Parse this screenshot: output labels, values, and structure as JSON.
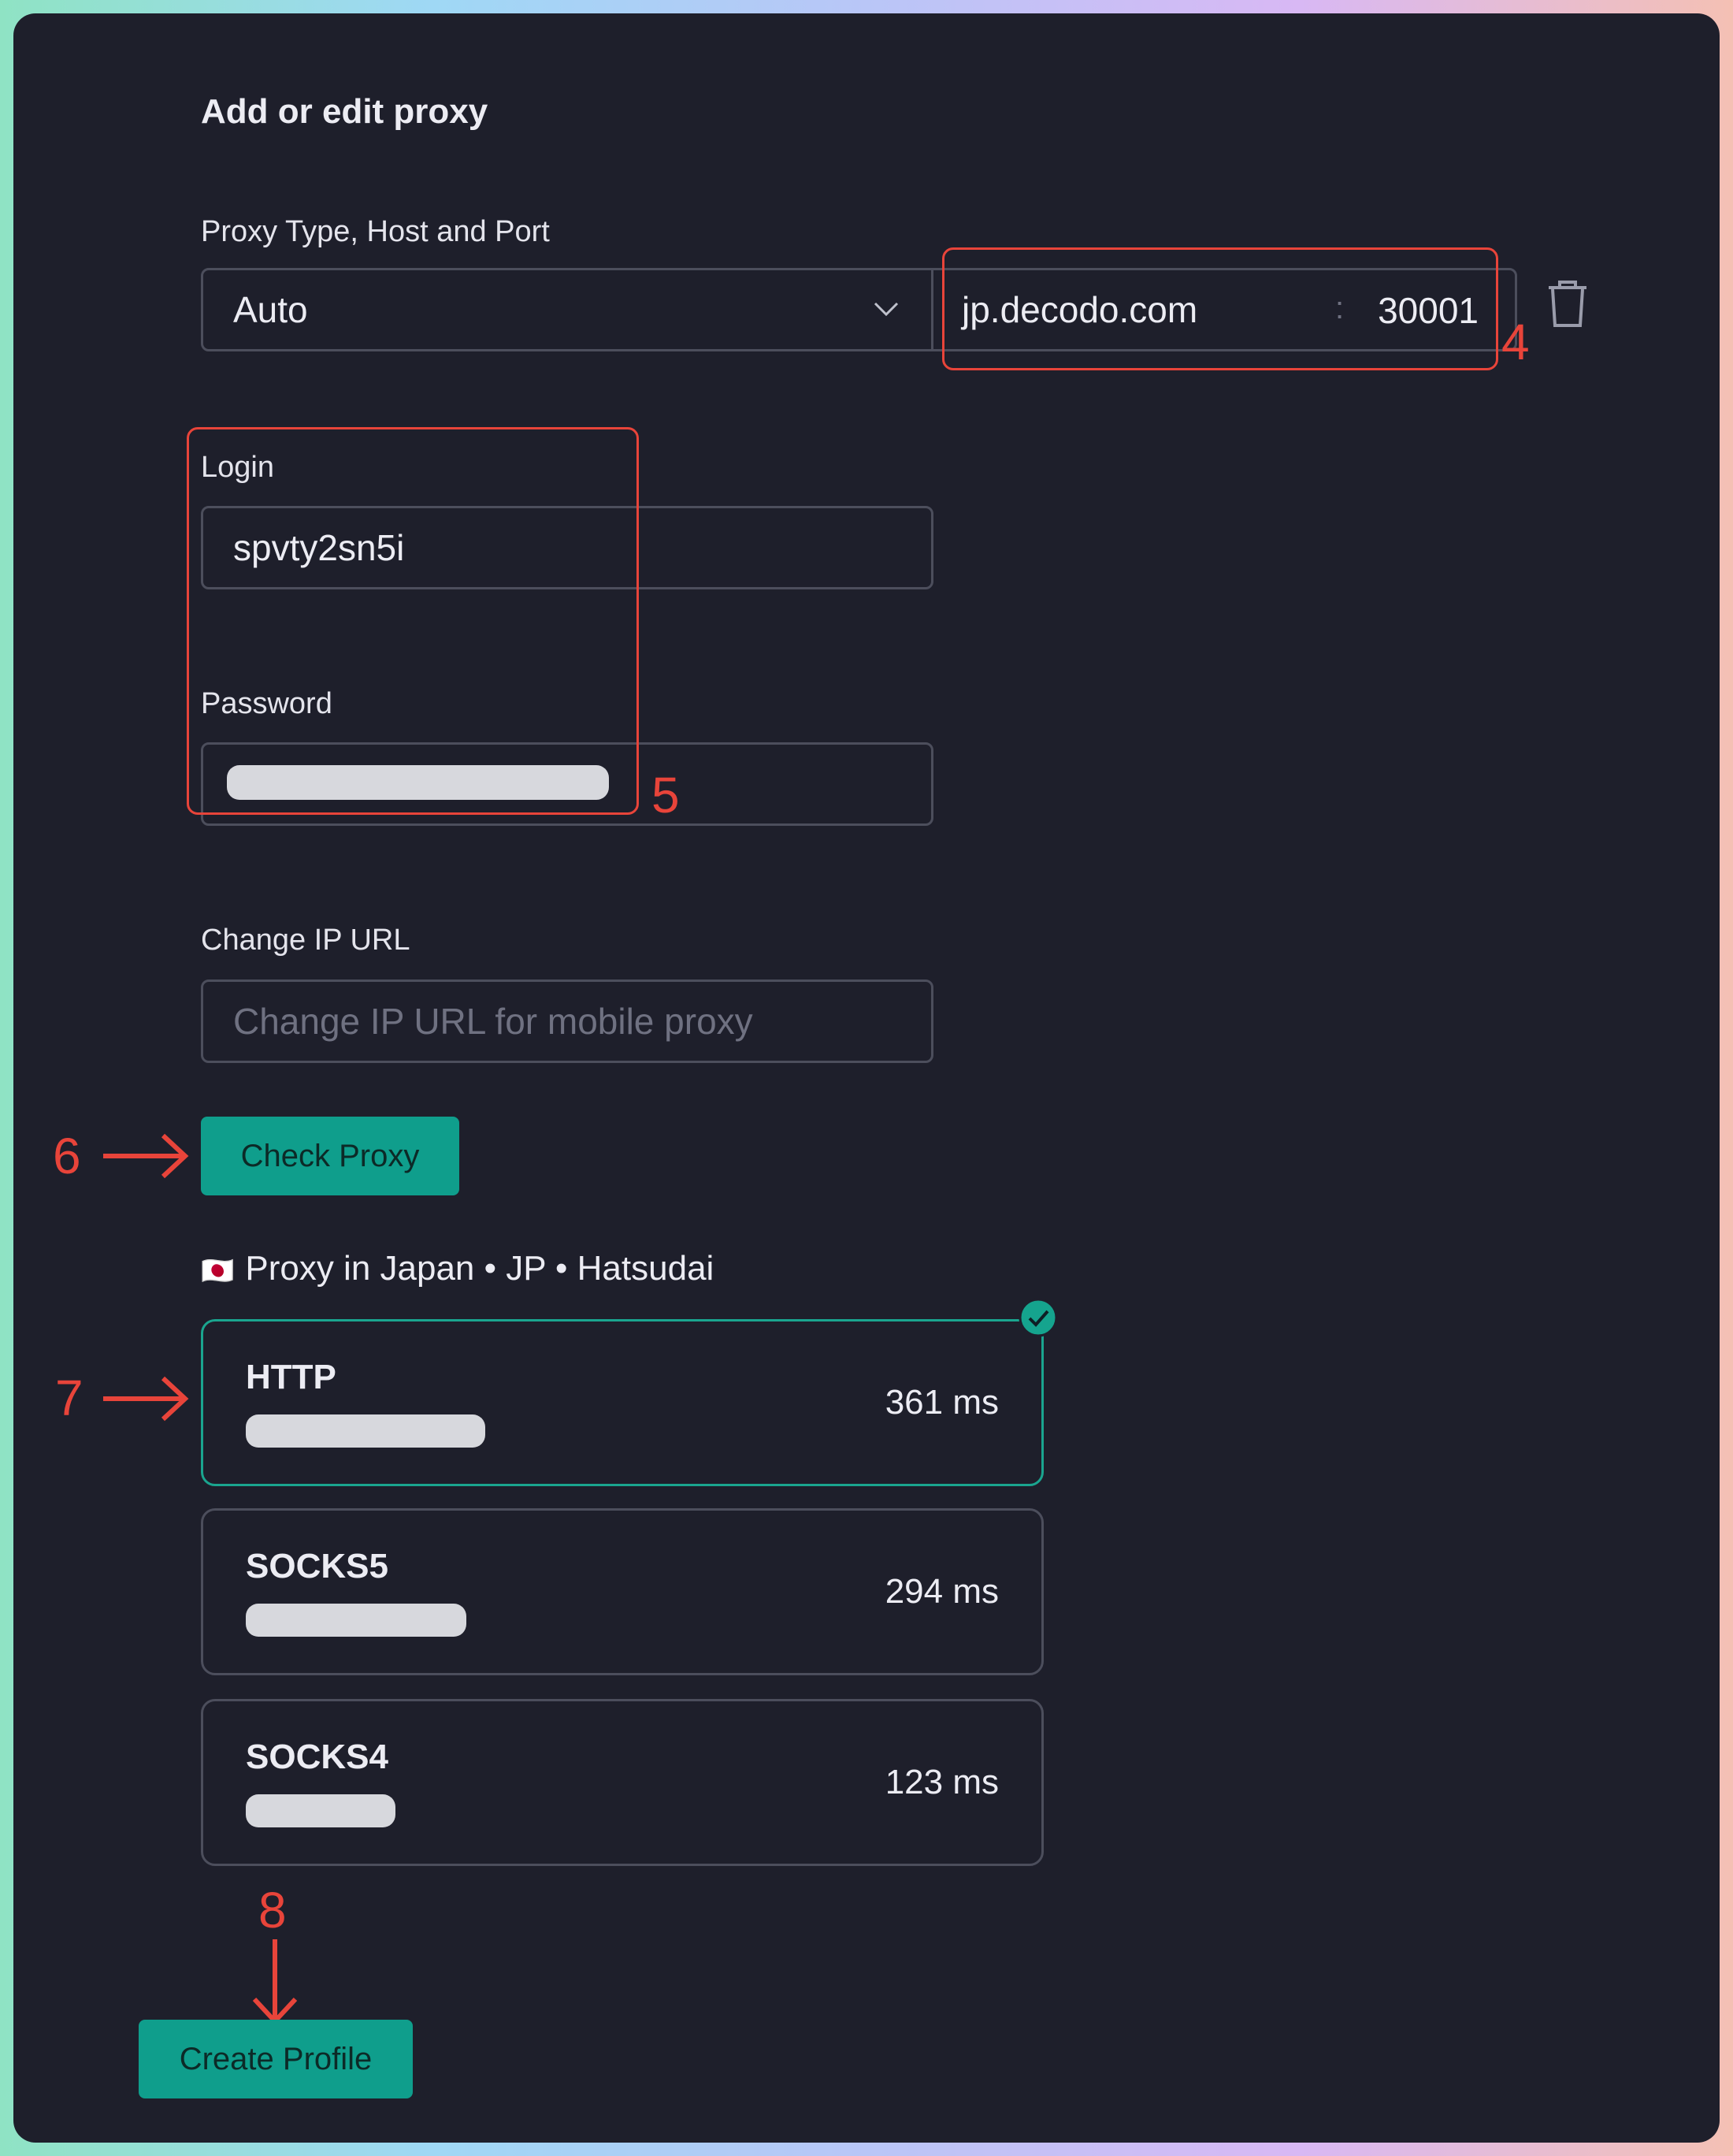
{
  "dialog": {
    "title": "Add or edit proxy",
    "proxy_section_label": "Proxy Type, Host and Port",
    "proxy_type": "Auto",
    "host": "jp.decodo.com",
    "port_separator": ":",
    "port": "30001",
    "login_label": "Login",
    "login_value": "spvty2sn5i",
    "password_label": "Password",
    "change_ip_label": "Change IP URL",
    "change_ip_placeholder": "Change IP URL for mobile proxy",
    "check_button": "Check Proxy",
    "location_flag": "🇯🇵",
    "location_text": "Proxy in Japan • JP • Hatsudai",
    "create_button": "Create Profile"
  },
  "proxy_results": [
    {
      "type": "HTTP",
      "latency": "361 ms",
      "selected": true
    },
    {
      "type": "SOCKS5",
      "latency": "294 ms",
      "selected": false
    },
    {
      "type": "SOCKS4",
      "latency": "123 ms",
      "selected": false
    }
  ],
  "annotations": {
    "n4": "4",
    "n5": "5",
    "n6": "6",
    "n7": "7",
    "n8": "8"
  },
  "colors": {
    "accent": "#0f9e8c",
    "annotation": "#e8443a",
    "background": "#1e1f2b"
  }
}
